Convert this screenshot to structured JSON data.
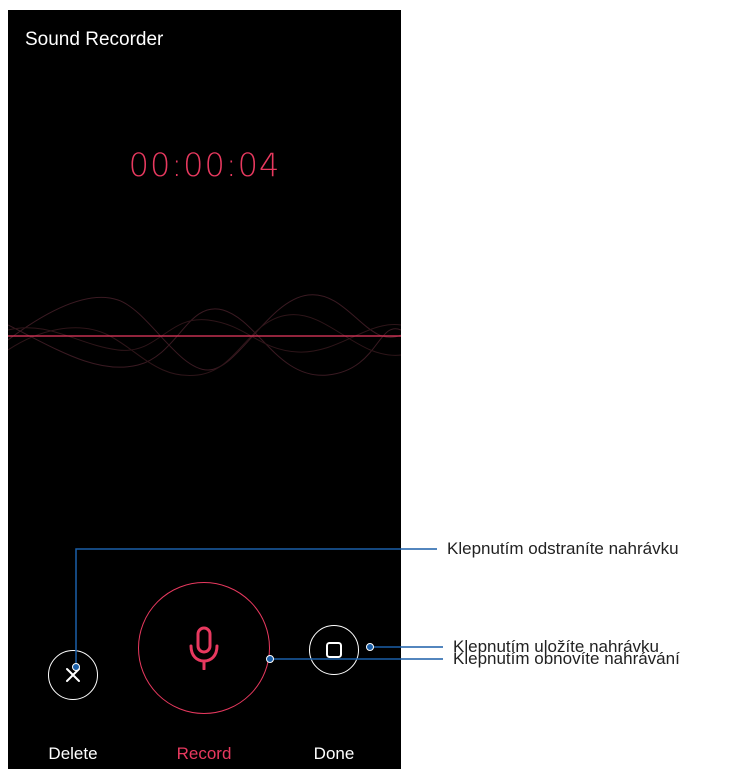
{
  "app": {
    "title": "Sound Recorder"
  },
  "recorder": {
    "elapsed_time": "00:00:04"
  },
  "controls": {
    "delete": {
      "label": "Delete",
      "icon": "close-icon"
    },
    "record": {
      "label": "Record",
      "icon": "microphone-icon"
    },
    "done": {
      "label": "Done",
      "icon": "stop-square-icon"
    }
  },
  "callouts": {
    "delete": "Klepnutím odstraníte nahrávku",
    "record": "Klepnutím obnovíte nahrávání",
    "done": "Klepnutím uložíte nahrávku"
  },
  "colors": {
    "accent": "#e8395f",
    "background": "#000000",
    "callout_line": "#1a5fa8",
    "text": "#ffffff"
  }
}
